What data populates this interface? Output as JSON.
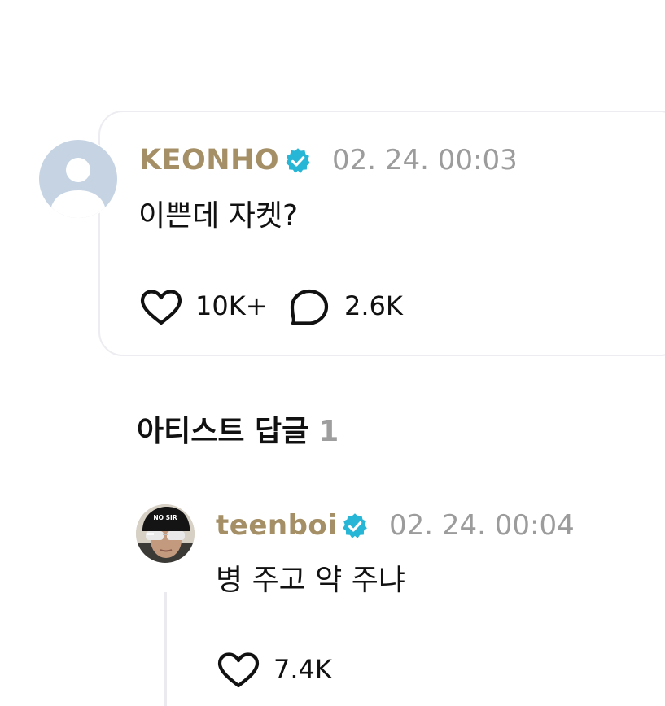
{
  "comment": {
    "author": "KEONHO",
    "timestamp": "02. 24. 00:03",
    "text": "이쁜데 자켓?",
    "likes": "10K+",
    "replies": "2.6K"
  },
  "artist_replies": {
    "title": "아티스트 답글",
    "count": "1"
  },
  "reply": {
    "author": "teenboi",
    "avatar_cap_text": "NO SIR",
    "timestamp": "02. 24. 00:04",
    "text": "병 주고 약 주냐",
    "likes": "7.4K"
  },
  "colors": {
    "author_name": "#a48f66",
    "verified_badge": "#27b6d6",
    "timestamp": "#9c9c9c",
    "card_border": "#ececf1",
    "section_count": "#9e9e9e"
  },
  "icons": {
    "verified": "verified-badge-icon",
    "like": "heart-outline-icon",
    "reply": "speech-bubble-icon",
    "default_avatar": "default-user-icon"
  }
}
